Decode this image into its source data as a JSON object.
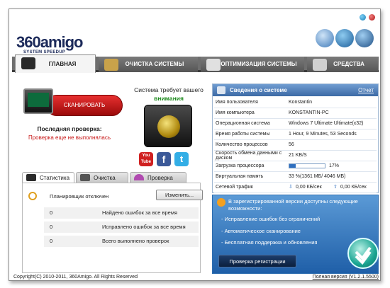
{
  "window": {
    "logo_big": "360amigo",
    "logo_sub": "SYSTEM SPEEDUP"
  },
  "tabs": [
    {
      "label": "ГЛАВНАЯ"
    },
    {
      "label": "ОЧИСТКА СИСТЕМЫ"
    },
    {
      "label": "ОПТИМИЗАЦИЯ СИСТЕМЫ"
    },
    {
      "label": "СРЕДСТВА"
    }
  ],
  "scan": {
    "button_label": "СКАНИРОВАТЬ",
    "last_check_label": "Последняя проверка:",
    "last_check_value": "Проверка еще не выполнялась"
  },
  "status": {
    "line1": "Система требует вашего",
    "line2": "внимания"
  },
  "social": [
    "You Tube",
    "f",
    "t"
  ],
  "system_info": {
    "title": "Сведения о системе",
    "report_link": "Отчет",
    "rows": [
      {
        "key": "Имя пользователя",
        "value": "Konstantin"
      },
      {
        "key": "Имя компьютера",
        "value": "KONSTANTIN-PC"
      },
      {
        "key": "Операционная система",
        "value": "Windows 7 Ultimate Ultimate(x32)"
      },
      {
        "key": "Время работы системы",
        "value": "1 Hour, 9 Minutes, 53 Seconds"
      },
      {
        "key": "Количество процессов",
        "value": "56"
      },
      {
        "key": "Скорость обмена данными с диском",
        "value": "21 KB/S"
      },
      {
        "key": "Загрузка процессора",
        "value": "17%"
      },
      {
        "key": "Виртуальная память",
        "value": "33 %(1361 МБ/ 4046 МБ)"
      },
      {
        "key": "Сетевой трафик",
        "value": ""
      }
    ],
    "cpu_load": 0.17,
    "traffic_down": "0,00 КБ/сек",
    "traffic_up": "0,00 КБ/сек"
  },
  "subtabs": [
    {
      "label": "Статистика"
    },
    {
      "label": "Очистка"
    },
    {
      "label": "Проверка"
    }
  ],
  "stats": {
    "scheduler_label": "Планировщик отключен",
    "change_button": "Изменить...",
    "rows": [
      {
        "num": "0",
        "text": "Найдено ошибок за все время"
      },
      {
        "num": "0",
        "text": "Исправлено ошибок за все время"
      },
      {
        "num": "0",
        "text": "Всего выполнено проверок"
      }
    ]
  },
  "registration": {
    "header": "В зарегистрированной версии доступны следующие возможности:",
    "items": [
      "- Исправление ошибок без ограничений",
      "- Автоматическое сканирование",
      "- Бесплатная поддержка и обновления"
    ],
    "button": "Проверка регистрации"
  },
  "footer": {
    "copyright": "Copyright(C) 2010-2011, 360Amigo. All Rights Reserved",
    "version": "Полная версия (V1.2.1.5500)"
  },
  "colors": {
    "accent_blue": "#3c6aa5",
    "scan_red": "#c81a1a",
    "attention_green": "#1d8a1d"
  }
}
